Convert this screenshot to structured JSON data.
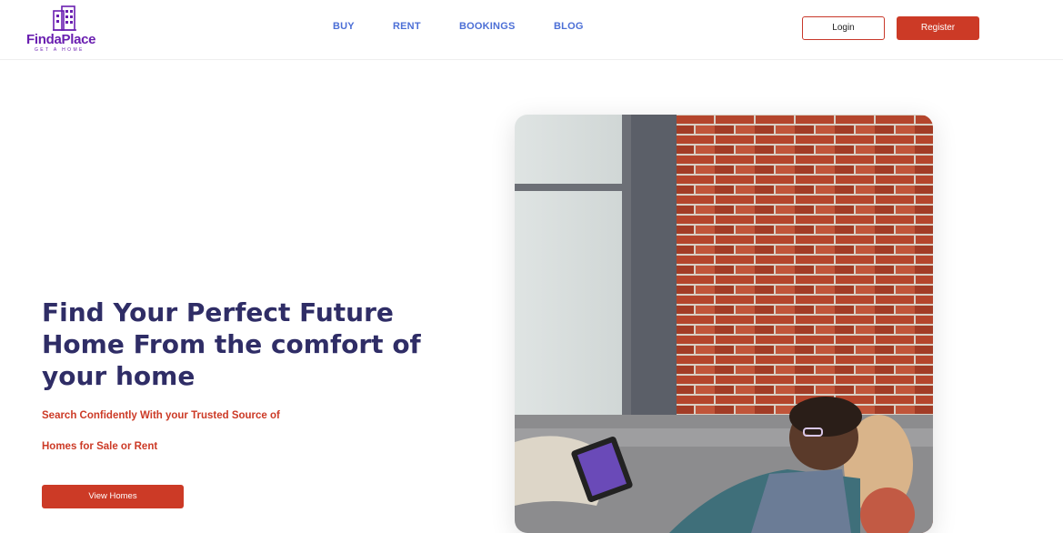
{
  "brand": {
    "name": "FindaPlace",
    "tagline": "GET A HOME",
    "color": "#6a1fb0"
  },
  "nav": {
    "items": [
      "BUY",
      "RENT",
      "BOOKINGS",
      "BLOG"
    ]
  },
  "auth": {
    "login_label": "Login",
    "register_label": "Register"
  },
  "hero": {
    "title": "Find Your Perfect Future Home From the comfort of your home",
    "subtitle_line1": "Search Confidently With your Trusted Source of",
    "subtitle_line2": "Homes for Sale or Rent",
    "cta_label": "View Homes"
  },
  "theme": {
    "accent": "#cc3a26",
    "title_color": "#2f2d66",
    "nav_color": "#4c6fd6"
  },
  "icons": {
    "logo": "building-icon"
  }
}
